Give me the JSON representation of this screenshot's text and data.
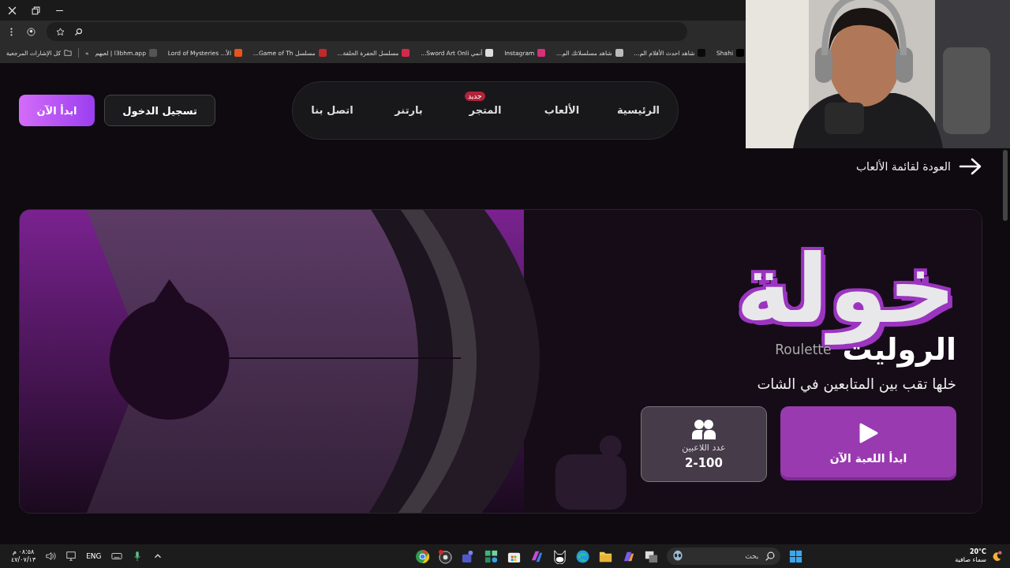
{
  "browser": {
    "all_bookmarks": "كل الإشارات المرجعية",
    "overflow": "»",
    "bookmarks": [
      {
        "label": "Shahi",
        "color": "#000000"
      },
      {
        "label": "شاهد احدث الأفلام الم...",
        "color": "#0a0a0a"
      },
      {
        "label": "شاهد مسلسلاتك الم...",
        "color": "#bbbbbb"
      },
      {
        "label": "Instagram",
        "color": "#d6307a"
      },
      {
        "label": "أنمي Sword Art Onli...",
        "color": "#dddddd"
      },
      {
        "label": "مسلسل الحفرة الحلقة...",
        "color": "#d42a4a"
      },
      {
        "label": "مسلسل Game of Th...",
        "color": "#c0282d"
      },
      {
        "label": "الأ... Lord of Mysteries",
        "color": "#e8541c"
      },
      {
        "label": "l3bhm.app | لعبهم",
        "color": "#555555"
      }
    ]
  },
  "header": {
    "start_button": "ابدأ الآن",
    "login_button": "تسجيل الدخول",
    "nav": [
      {
        "label": "الرئيسية",
        "selected": false
      },
      {
        "label": "الألعاب",
        "selected": false
      },
      {
        "label": "المتجر",
        "selected": false,
        "badge": "جديد"
      },
      {
        "label": "بارتنر",
        "selected": false
      },
      {
        "label": "اتصل بنا",
        "selected": false
      }
    ]
  },
  "back_link": "العودة لقائمة الألعاب",
  "hero": {
    "logo": "خولة",
    "title": "الروليت",
    "title_en": "Roulette",
    "subtitle": "خلها تقب بين المتابعين في الشات",
    "players_label": "عدد اللاعبين",
    "players_value": "2-100",
    "play_button": "ابدأ اللعبة الآن"
  },
  "taskbar": {
    "time": "٠٨:٥٨ م",
    "date": "٤٧/٠٧/١٣",
    "language": "ENG",
    "search_placeholder": "بحث",
    "temperature": "20°C",
    "weather": "سماء صافية"
  }
}
